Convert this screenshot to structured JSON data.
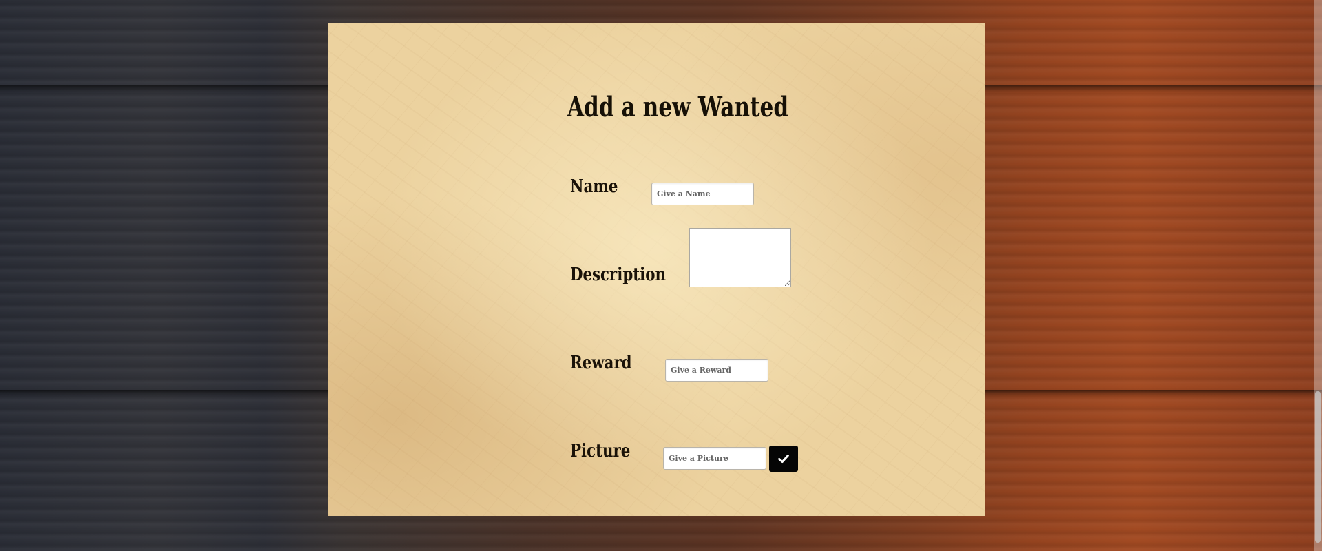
{
  "form": {
    "title": "Add a new Wanted",
    "fields": {
      "name": {
        "label": "Name",
        "placeholder": "Give a Name"
      },
      "description": {
        "label": "Description",
        "placeholder": ""
      },
      "reward": {
        "label": "Reward",
        "placeholder": "Give a Reward"
      },
      "picture": {
        "label": "Picture",
        "placeholder": "Give a Picture"
      }
    },
    "submit_icon": "check-icon"
  },
  "colors": {
    "parchment": "#ecd29f",
    "submit_button": "#050505",
    "text": "#161006"
  }
}
